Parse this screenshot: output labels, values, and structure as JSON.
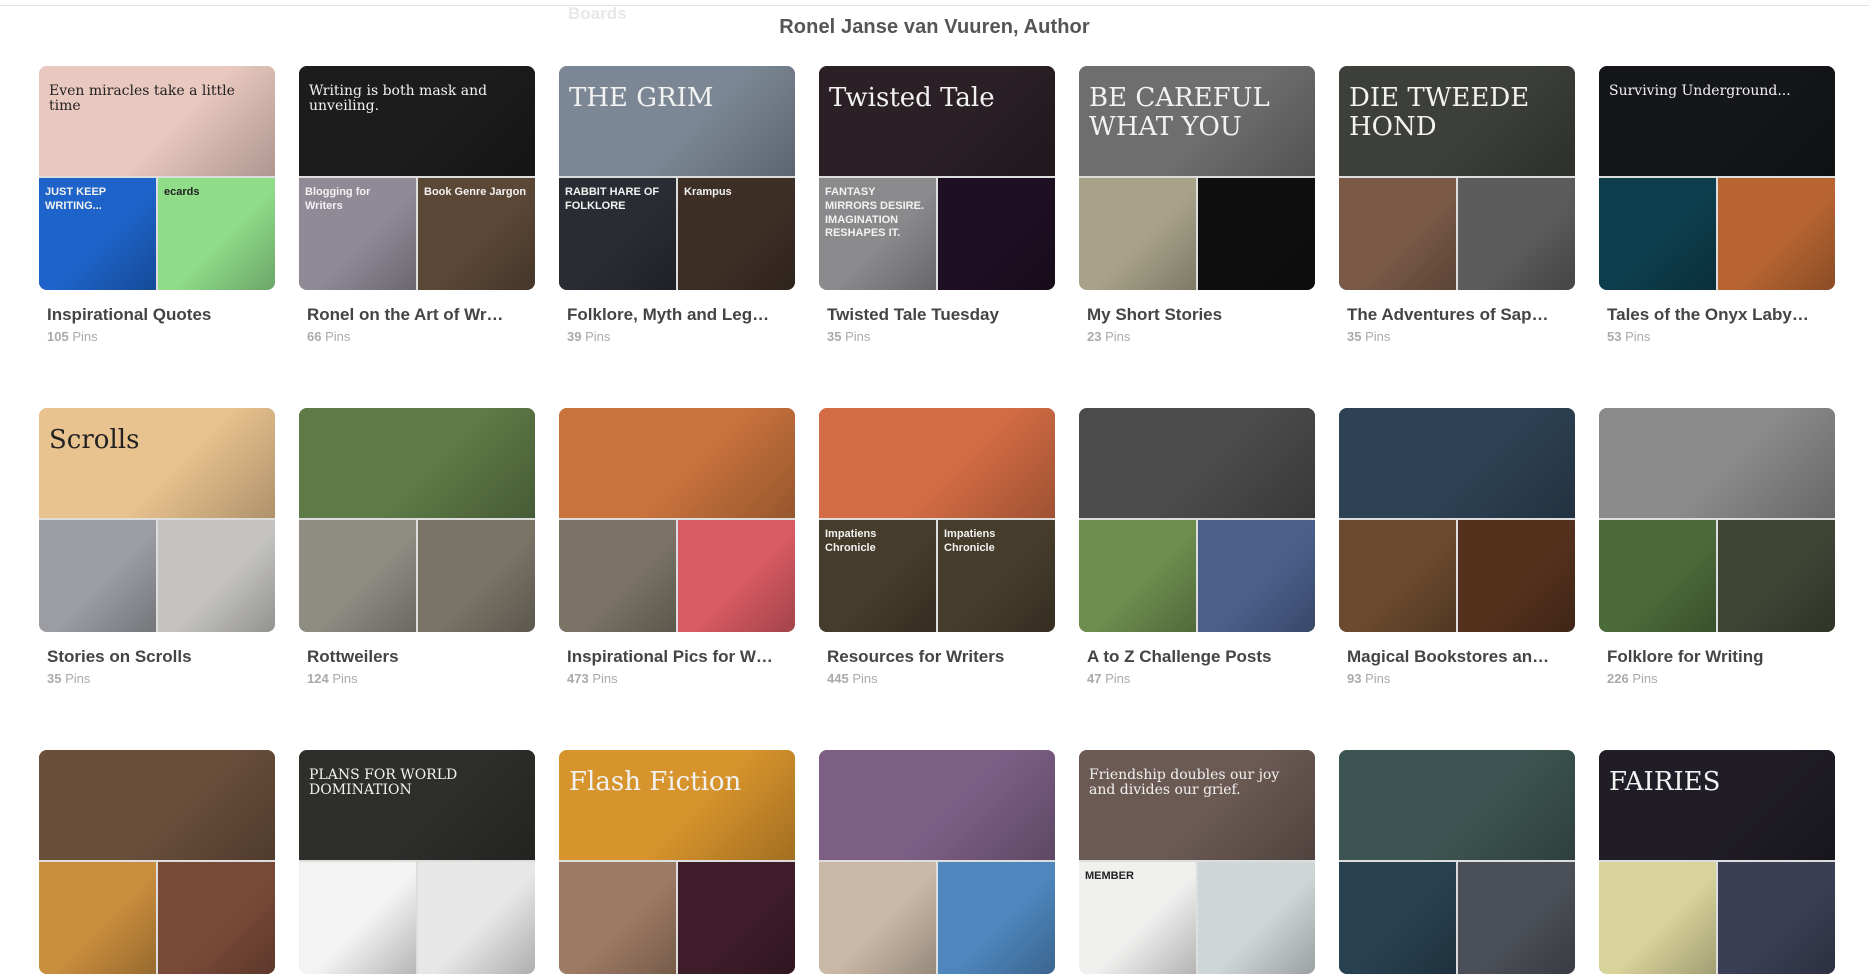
{
  "header": {
    "ghost_nav": "Boards",
    "profile_name": "Ronel Janse van Vuuren, Author"
  },
  "pins_suffix": "Pins",
  "boards": [
    {
      "title": "Inspirational Quotes",
      "count": "105",
      "main_text": "Even miracles take a little time",
      "a_text": "JUST KEEP WRITING...",
      "b_text": "ecards",
      "colors": {
        "main": "#e9c9bf",
        "a": "#1d63c9",
        "b": "#8fdc89"
      }
    },
    {
      "title": "Ronel on the Art of Wr…",
      "count": "66",
      "main_text": "Writing is both mask and unveiling.",
      "a_text": "Blogging for Writers",
      "b_text": "Book Genre Jargon",
      "colors": {
        "main": "#1c1c1c",
        "a": "#8f8a96",
        "b": "#5b4736"
      }
    },
    {
      "title": "Folklore, Myth and Leg…",
      "count": "39",
      "main_text": "THE GRIM",
      "a_text": "RABBIT HARE OF FOLKLORE",
      "b_text": "Krampus",
      "colors": {
        "main": "#7b8794",
        "a": "#2a2c33",
        "b": "#3d2f26"
      }
    },
    {
      "title": "Twisted Tale Tuesday",
      "count": "35",
      "main_text": "Twisted Tale",
      "a_text": "FANTASY MIRRORS DESIRE. IMAGINATION RESHAPES IT.",
      "b_text": "",
      "colors": {
        "main": "#2a2026",
        "a": "#8a8a8d",
        "b": "#1e0f22"
      }
    },
    {
      "title": "My Short Stories",
      "count": "23",
      "main_text": "BE CAREFUL WHAT YOU",
      "a_text": "",
      "b_text": "",
      "colors": {
        "main": "#6e6e6e",
        "a": "#a8a289",
        "b": "#0f0f10"
      }
    },
    {
      "title": "The Adventures of Sap…",
      "count": "35",
      "main_text": "DIE TWEEDE HOND",
      "a_text": "",
      "b_text": "",
      "colors": {
        "main": "#3c3f3a",
        "a": "#7a5a47",
        "b": "#5c5c5c"
      }
    },
    {
      "title": "Tales of the Onyx Laby…",
      "count": "53",
      "main_text": "Surviving Underground...",
      "a_text": "",
      "b_text": "",
      "colors": {
        "main": "#14161a",
        "a": "#0d3e4d",
        "b": "#b86532"
      }
    },
    {
      "title": "Stories on Scrolls",
      "count": "35",
      "main_text": "Scrolls",
      "a_text": "",
      "b_text": "",
      "colors": {
        "main": "#e9c38f",
        "a": "#9b9da3",
        "b": "#c4c3c0"
      }
    },
    {
      "title": "Rottweilers",
      "count": "124",
      "main_text": "",
      "a_text": "",
      "b_text": "",
      "colors": {
        "main": "#5e7a47",
        "a": "#8e8c83",
        "b": "#7a7467"
      }
    },
    {
      "title": "Inspirational Pics for W…",
      "count": "473",
      "main_text": "",
      "a_text": "",
      "b_text": "",
      "colors": {
        "main": "#c9733d",
        "a": "#7b7466",
        "b": "#d85a63"
      }
    },
    {
      "title": "Resources for Writers",
      "count": "445",
      "main_text": "",
      "a_text": "Impatiens Chronicle",
      "b_text": "Impatiens Chronicle",
      "colors": {
        "main": "#d46d45",
        "a": "#453c2b",
        "b": "#453c2b"
      }
    },
    {
      "title": "A to Z Challenge Posts",
      "count": "47",
      "main_text": "",
      "a_text": "",
      "b_text": "",
      "colors": {
        "main": "#4b4b4b",
        "a": "#6c8d4e",
        "b": "#4a5f8a"
      }
    },
    {
      "title": "Magical Bookstores an…",
      "count": "93",
      "main_text": "",
      "a_text": "",
      "b_text": "",
      "colors": {
        "main": "#2e4255",
        "a": "#6b4a2f",
        "b": "#54311d"
      }
    },
    {
      "title": "Folklore for Writing",
      "count": "226",
      "main_text": "",
      "a_text": "",
      "b_text": "",
      "colors": {
        "main": "#8a8a8a",
        "a": "#4c6b3b",
        "b": "#3f4435"
      }
    },
    {
      "title": "",
      "count": "",
      "main_text": "",
      "a_text": "",
      "b_text": "",
      "colors": {
        "main": "#6a4f3b",
        "a": "#c98d3e",
        "b": "#7a4a38"
      }
    },
    {
      "title": "",
      "count": "",
      "main_text": "PLANS FOR WORLD DOMINATION",
      "a_text": "",
      "b_text": "",
      "colors": {
        "main": "#2e2f2b",
        "a": "#f3f3f3",
        "b": "#e7e7e7"
      }
    },
    {
      "title": "",
      "count": "",
      "main_text": "Flash Fiction",
      "a_text": "",
      "b_text": "",
      "colors": {
        "main": "#d8942c",
        "a": "#9d7a63",
        "b": "#3f1c2a"
      }
    },
    {
      "title": "",
      "count": "",
      "main_text": "",
      "a_text": "",
      "b_text": "",
      "colors": {
        "main": "#7d5f86",
        "a": "#c9b8a5",
        "b": "#4e86bd"
      }
    },
    {
      "title": "",
      "count": "",
      "main_text": "Friendship doubles our joy and divides our grief.",
      "a_text": "MEMBER",
      "b_text": "",
      "colors": {
        "main": "#6b5a54",
        "a": "#f0f0ef",
        "b": "#cfd6d8"
      }
    },
    {
      "title": "",
      "count": "",
      "main_text": "",
      "a_text": "",
      "b_text": "",
      "colors": {
        "main": "#3d5552",
        "a": "#284151",
        "b": "#4b4f57"
      }
    },
    {
      "title": "",
      "count": "",
      "main_text": "FAIRIES",
      "a_text": "",
      "b_text": "",
      "colors": {
        "main": "#201d26",
        "a": "#d8d39a",
        "b": "#3a3f55"
      }
    }
  ]
}
